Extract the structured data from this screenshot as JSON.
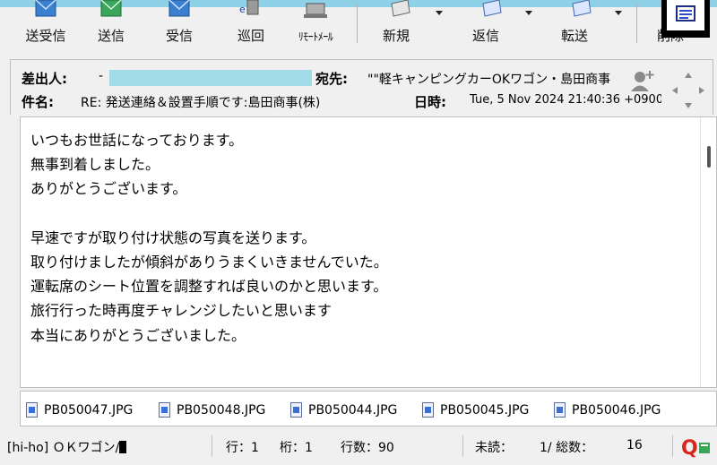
{
  "toolbar": {
    "send_receive": "送受信",
    "send": "送信",
    "receive": "受信",
    "patrol": "巡回",
    "remote_mail": "ﾘﾓｰﾄﾒｰﾙ",
    "new": "新規",
    "reply": "返信",
    "forward": "転送",
    "delete": "削除"
  },
  "header": {
    "from_label": "差出人:",
    "from_value": "",
    "to_label": "宛先:",
    "to_value": "\"\"軽キャンピングカーOKワゴン・島田商事",
    "subject_label": "件名:",
    "subject_value": "RE: 発送連絡＆設置手順です:島田商事(株)",
    "date_label": "日時:",
    "date_value": "Tue, 5 Nov 2024 21:40:36 +0900"
  },
  "body": {
    "lines": [
      "いつもお世話になっております。",
      "無事到着しました。",
      "ありがとうございます。",
      "",
      "早速ですが取り付け状態の写真を送ります。",
      "取り付けましたが傾斜がありうまくいきませんでいた。",
      "運転席のシート位置を調整すれば良いのかと思います。",
      "旅行行った時再度チャレンジしたいと思います",
      "本当にありがとうございました。"
    ]
  },
  "attachments": [
    "PB050047.JPG",
    "PB050048.JPG",
    "PB050044.JPG",
    "PB050045.JPG",
    "PB050046.JPG"
  ],
  "status": {
    "folder": "[hi-ho] ＯＫワゴン/",
    "line": "行：1",
    "column": "桁：1",
    "line_count": "行数：90",
    "unread": "未読：",
    "ratio": "1/ 総数：",
    "total": "16"
  },
  "colors": {
    "accent_strip": "#8ed0e6",
    "redacted": "#a3dce9",
    "icon_blue": "#3b7fd0",
    "icon_green": "#3aa65a",
    "q_red": "#d8261f"
  }
}
